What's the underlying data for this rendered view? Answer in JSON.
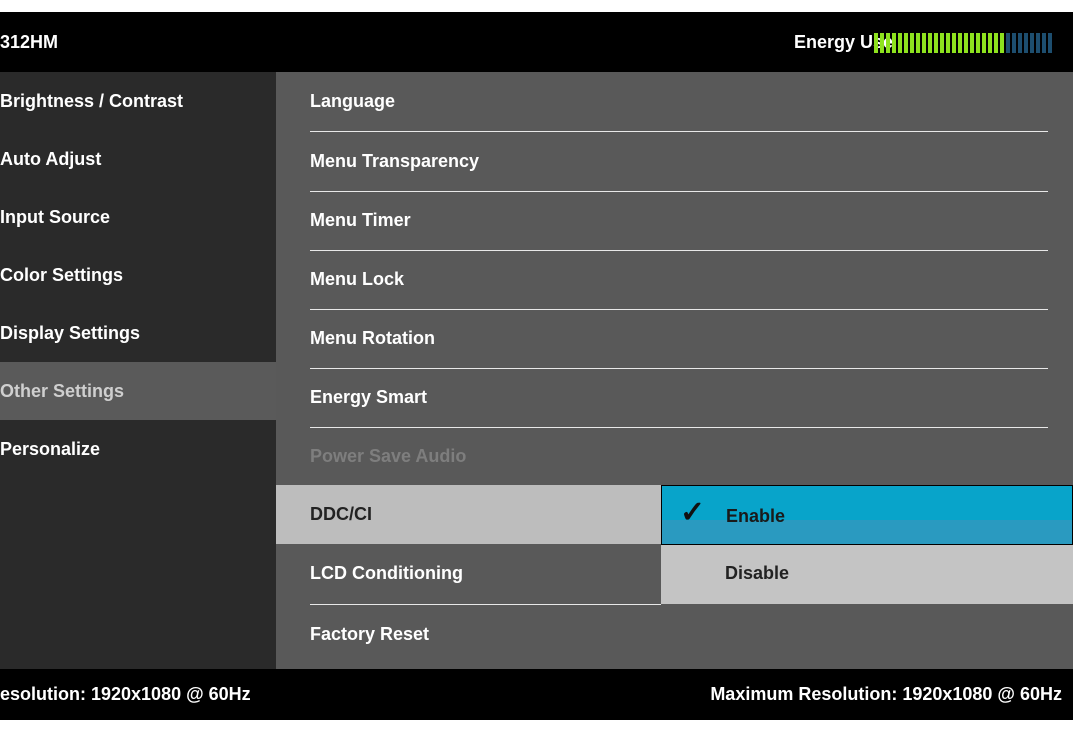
{
  "header": {
    "model": "312HM",
    "energy_label": "Energy Use",
    "energy_level_fraction": 0.72,
    "energy_on_color": "#8ee21e",
    "energy_off_color": "#1d4e6f"
  },
  "nav": {
    "items": [
      {
        "label": "Brightness / Contrast"
      },
      {
        "label": "Auto Adjust"
      },
      {
        "label": "Input Source"
      },
      {
        "label": "Color Settings"
      },
      {
        "label": "Display Settings"
      },
      {
        "label": "Other Settings",
        "selected": true
      },
      {
        "label": "Personalize"
      }
    ]
  },
  "other_settings": {
    "items": [
      {
        "label": "Language"
      },
      {
        "label": "Menu Transparency"
      },
      {
        "label": "Menu Timer"
      },
      {
        "label": "Menu Lock"
      },
      {
        "label": "Menu Rotation"
      },
      {
        "label": "Energy Smart"
      },
      {
        "label": "Power Save Audio",
        "disabled": true
      },
      {
        "label": "DDC/CI",
        "highlighted": true
      },
      {
        "label": "LCD Conditioning"
      },
      {
        "label": "Factory Reset"
      }
    ]
  },
  "ddc_options": {
    "enable": "Enable",
    "disable": "Disable",
    "selected": "Enable",
    "accent_color": "#08a4ca"
  },
  "footer": {
    "current_resolution": "esolution: 1920x1080 @ 60Hz",
    "max_resolution": "Maximum Resolution: 1920x1080 @ 60Hz"
  }
}
